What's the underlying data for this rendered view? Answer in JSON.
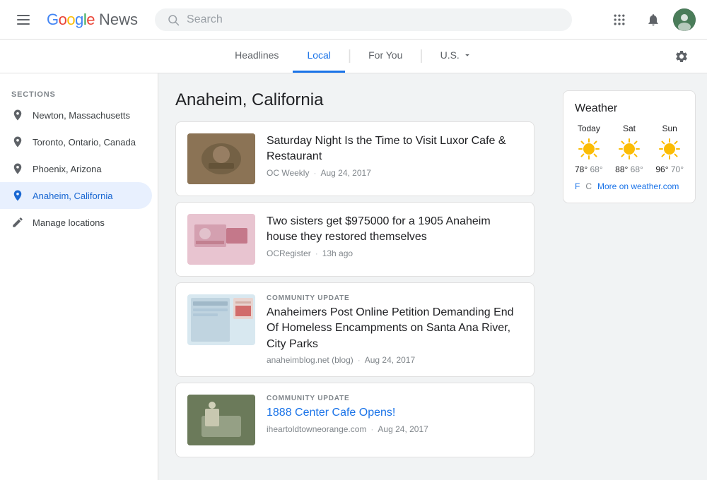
{
  "header": {
    "menu_label": "Menu",
    "logo_google": "Google",
    "logo_news": "News",
    "search_placeholder": "Search",
    "settings_label": "Settings"
  },
  "nav": {
    "tabs": [
      {
        "label": "Headlines",
        "active": false
      },
      {
        "label": "Local",
        "active": true
      },
      {
        "label": "For You",
        "active": false
      },
      {
        "label": "U.S.",
        "active": false,
        "has_dropdown": true
      }
    ]
  },
  "sidebar": {
    "section_label": "SECTIONS",
    "items": [
      {
        "label": "Newton, Massachusetts",
        "icon": "location-icon",
        "active": false
      },
      {
        "label": "Toronto, Ontario, Canada",
        "icon": "location-icon",
        "active": false
      },
      {
        "label": "Phoenix, Arizona",
        "icon": "location-icon",
        "active": false
      },
      {
        "label": "Anaheim, California",
        "icon": "location-icon",
        "active": true
      },
      {
        "label": "Manage locations",
        "icon": "edit-icon",
        "active": false
      }
    ]
  },
  "main": {
    "page_title": "Anaheim, California",
    "articles": [
      {
        "id": "1",
        "community_badge": "",
        "headline": "Saturday Night Is the Time to Visit Luxor Cafe & Restaurant",
        "source": "OC Weekly",
        "time": "Aug 24, 2017",
        "has_thumb": true,
        "thumb_type": "1"
      },
      {
        "id": "2",
        "community_badge": "",
        "headline": "Two sisters get $975000 for a 1905 Anaheim house they restored themselves",
        "source": "OCRegister",
        "time": "13h ago",
        "has_thumb": true,
        "thumb_type": "2"
      },
      {
        "id": "3",
        "community_badge": "COMMUNITY UPDATE",
        "headline": "Anaheimers Post Online Petition Demanding End Of Homeless Encampments on Santa Ana River, City Parks",
        "source": "anaheimblog.net (blog)",
        "time": "Aug 24, 2017",
        "has_thumb": true,
        "thumb_type": "3"
      },
      {
        "id": "4",
        "community_badge": "COMMUNITY UPDATE",
        "headline": "1888 Center Cafe Opens!",
        "headline_is_link": true,
        "source": "iheartoldtowneorange.com",
        "time": "Aug 24, 2017",
        "has_thumb": true,
        "thumb_type": "4"
      }
    ]
  },
  "weather": {
    "title": "Weather",
    "days": [
      {
        "label": "Today",
        "high": "78°",
        "low": "68°"
      },
      {
        "label": "Sat",
        "high": "88°",
        "low": "68°"
      },
      {
        "label": "Sun",
        "high": "96°",
        "low": "70°"
      }
    ],
    "unit_f": "F",
    "unit_c": "C",
    "more_link": "More on weather.com"
  }
}
